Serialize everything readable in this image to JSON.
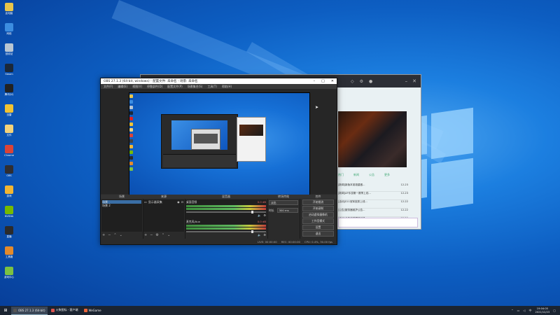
{
  "desktop": {
    "icons": [
      {
        "label": "此电脑",
        "icon": "computer-icon",
        "color": "#e8c54a"
      },
      {
        "label": "网络",
        "icon": "network-icon",
        "color": "#3c8de0"
      },
      {
        "label": "回收站",
        "icon": "recycle-bin-icon",
        "color": "#b9c6d2"
      },
      {
        "label": "Steam",
        "icon": "steam-icon",
        "color": "#1b2838"
      },
      {
        "label": "腾讯QQ",
        "icon": "qq-icon",
        "color": "#222222"
      },
      {
        "label": "迅雷",
        "icon": "thunder-icon",
        "color": "#f1c232"
      },
      {
        "label": "文件",
        "icon": "folder-icon",
        "color": "#f3d27a"
      },
      {
        "label": "Chrome",
        "icon": "chrome-icon",
        "color": "#db4437"
      },
      {
        "label": "OBS",
        "icon": "obs-icon",
        "color": "#302e31"
      },
      {
        "label": "游戏",
        "icon": "game-icon",
        "color": "#f2b632"
      },
      {
        "label": "NVIDIA",
        "icon": "nvidia-icon",
        "color": "#76b900"
      },
      {
        "label": "直播",
        "icon": "live-icon",
        "color": "#2b2b2b"
      },
      {
        "label": "工具箱",
        "icon": "toolbox-icon",
        "color": "#e38a2b"
      },
      {
        "label": "游戏中心",
        "icon": "game-center-icon",
        "color": "#7cc142"
      }
    ]
  },
  "backwin": {
    "tabs": [
      "热门",
      "新闻",
      "公告",
      "更多"
    ],
    "news": [
      {
        "text": "[新闻]新版本英雄重做...",
        "date": "12-23"
      },
      {
        "text": "[新闻]AP手游第一赛季上线...",
        "date": "12-23"
      },
      {
        "text": "[活动]S11冠军皮肤上线...",
        "date": "12-22"
      },
      {
        "text": "[公告]服务器维护公告...",
        "date": "12-22"
      },
      {
        "text": "[活动]全新皮肤限时返场...",
        "date": "12-20"
      }
    ]
  },
  "obs": {
    "title": "OBS 27.1.3 (64-bit, windows) - 配置文件: 未命名 - 场景: 未命名",
    "menu": [
      "文件(F)",
      "编辑(E)",
      "视图(V)",
      "停靠部件(D)",
      "配置文件(P)",
      "场景集合(S)",
      "工具(T)",
      "帮助(H)"
    ],
    "docks": {
      "scenes": {
        "header": "场景",
        "items": [
          "场景",
          "场景 2"
        ]
      },
      "sources": {
        "header": "来源",
        "items": [
          "显示器采集"
        ]
      },
      "mixer": {
        "header": "混音器",
        "channels": [
          {
            "name": "桌面音频",
            "db": "0.0 dB"
          },
          {
            "name": "麦克风/Aux",
            "db": "0.0 dB"
          }
        ]
      },
      "transitions": {
        "header": "转场特效",
        "type": "淡出",
        "duration_label": "时长",
        "duration": "300 ms"
      },
      "controls": {
        "header": "控件",
        "buttons": [
          "开始推流",
          "开始录制",
          "启动虚拟摄像机",
          "工作室模式",
          "设置",
          "退出"
        ]
      }
    },
    "status": {
      "live": "LIVE: 00:00:00",
      "rec": "REC: 00:00:00",
      "cpu": "CPU: 0.4%, 30.00 fps"
    }
  },
  "taskbar": {
    "items": [
      {
        "label": "OBS 27.1.3 (64-bit)",
        "icon": "obs-icon",
        "color": "#555555",
        "active": true
      },
      {
        "label": "火柴图标 - 客户端",
        "icon": "app-icon",
        "color": "#d9534f",
        "active": false
      },
      {
        "label": "WeGame",
        "icon": "wegame-icon",
        "color": "#e8643b",
        "active": false
      }
    ],
    "time": "19:04:05",
    "date": "2021/12/23"
  }
}
